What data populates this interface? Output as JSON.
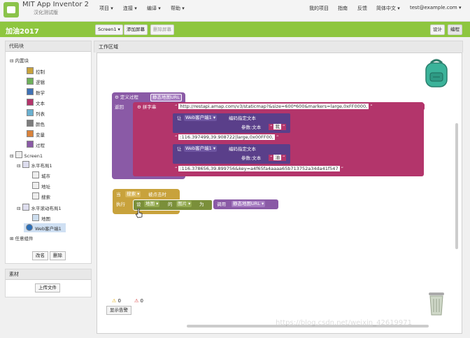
{
  "header": {
    "brand": "MIT App Inventor 2",
    "brand_sub": "汉化测试版",
    "menus": [
      "项目 ▾",
      "连接 ▾",
      "编译 ▾",
      "帮助 ▾"
    ],
    "right_links": [
      "我的项目",
      "指南",
      "反馈",
      "简体中文 ▾",
      "test@example.com ▾"
    ]
  },
  "project": {
    "name": "加油2017",
    "screen": "Screen1 ▾",
    "add_screen": "添加屏幕",
    "remove_screen": "删除屏幕",
    "designer": "设计",
    "blocks": "编程"
  },
  "blocks_panel": {
    "title": "代码块",
    "builtin": "内置块",
    "builtin_items": [
      {
        "label": "控制",
        "color": "#c8a23c"
      },
      {
        "label": "逻辑",
        "color": "#6eb05b"
      },
      {
        "label": "数学",
        "color": "#3f72b5"
      },
      {
        "label": "文本",
        "color": "#b3356b"
      },
      {
        "label": "列表",
        "color": "#6ab0d0"
      },
      {
        "label": "颜色",
        "color": "#7d7d7d"
      },
      {
        "label": "变量",
        "color": "#d9823a"
      },
      {
        "label": "过程",
        "color": "#8a5aa6"
      }
    ],
    "screen": "Screen1",
    "h_layout": "水平布局1",
    "h_items": [
      "城市",
      "地址",
      "搜索"
    ],
    "hs_layout": "水平滚动布局1",
    "hs_items": [
      "地图"
    ],
    "web": "Web客户端1",
    "any": "任意组件",
    "rename": "改名",
    "delete": "删除"
  },
  "media": {
    "title": "素材",
    "upload": "上传文件"
  },
  "workspace": {
    "title": "工作区域",
    "warn_count": "0",
    "err_count": "0",
    "show_warnings": "显示告警",
    "watermark": "https://blog.csdn.net/weixin_42619971"
  },
  "code": {
    "proc_def": "定义过程",
    "proc_name": "静态地图URL",
    "ret": "返回",
    "join": "拼字串",
    "url1": "http://restapi.amap.com/v3/staticmap?&size=600*600&markers=large,0xFF0000,",
    "let": "让",
    "web1": "Web客户端1 ▾",
    "encode": "编码指定文本",
    "param": "参数:文本",
    "text_a": "我",
    "url2": ":116.397499,39.908722|large,0x00FF00,",
    "text_b": "油",
    "url3": ":116.378656,39.899756&key=a4f65fa4aaaa65b713752a34da41f547",
    "when": "当",
    "search": "搜索 ▾",
    "clicked": "被点击时",
    "do": "执行",
    "set": "设",
    "map": "地图 ▾",
    "of": "的",
    "image": "图片 ▾",
    "to": "为",
    "call": "调用",
    "call_name": "静态地图URL ▾"
  }
}
